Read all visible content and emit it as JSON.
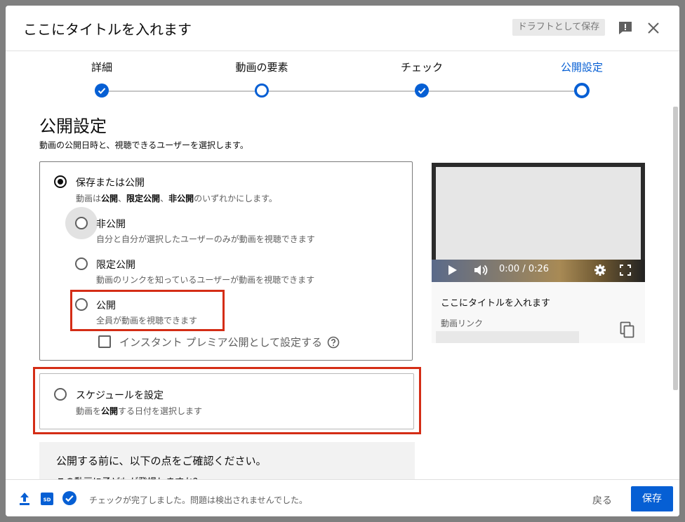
{
  "header": {
    "title": "ここにタイトルを入れます",
    "draft_label": "ドラフトとして保存"
  },
  "stepper": {
    "steps": [
      {
        "label": "詳細",
        "state": "done"
      },
      {
        "label": "動画の要素",
        "state": "current"
      },
      {
        "label": "チェック",
        "state": "done"
      },
      {
        "label": "公開設定",
        "state": "active"
      }
    ]
  },
  "visibility": {
    "title": "公開設定",
    "description": "動画の公開日時と、視聴できるユーザーを選択します。",
    "save_or_publish": {
      "label": "保存または公開",
      "desc_pre": "動画は",
      "desc_b1": "公開",
      "desc_sep1": "、",
      "desc_b2": "限定公開",
      "desc_sep2": "、",
      "desc_b3": "非公開",
      "desc_post": "のいずれかにします。",
      "options": [
        {
          "label": "非公開",
          "desc": "自分と自分が選択したユーザーのみが動画を視聴できます"
        },
        {
          "label": "限定公開",
          "desc": "動画のリンクを知っているユーザーが動画を視聴できます"
        },
        {
          "label": "公開",
          "desc": "全員が動画を視聴できます"
        }
      ],
      "premiere_label": "インスタント プレミア公開として設定する"
    },
    "schedule": {
      "label": "スケジュールを設定",
      "desc_pre": "動画を",
      "desc_b": "公開",
      "desc_post": "する日付を選択します"
    },
    "notice": {
      "title": "公開する前に、以下の点をご確認ください。",
      "cut_text": "この動画に子どもが登場しますか？"
    }
  },
  "preview": {
    "time": "0:00 / 0:26",
    "title": "ここにタイトルを入れます",
    "link_label": "動画リンク"
  },
  "footer": {
    "status": "チェックが完了しました。問題は検出されませんでした。",
    "back_label": "戻る",
    "save_label": "保存"
  },
  "colors": {
    "accent": "#065fd4",
    "highlight": "#d42d16"
  }
}
